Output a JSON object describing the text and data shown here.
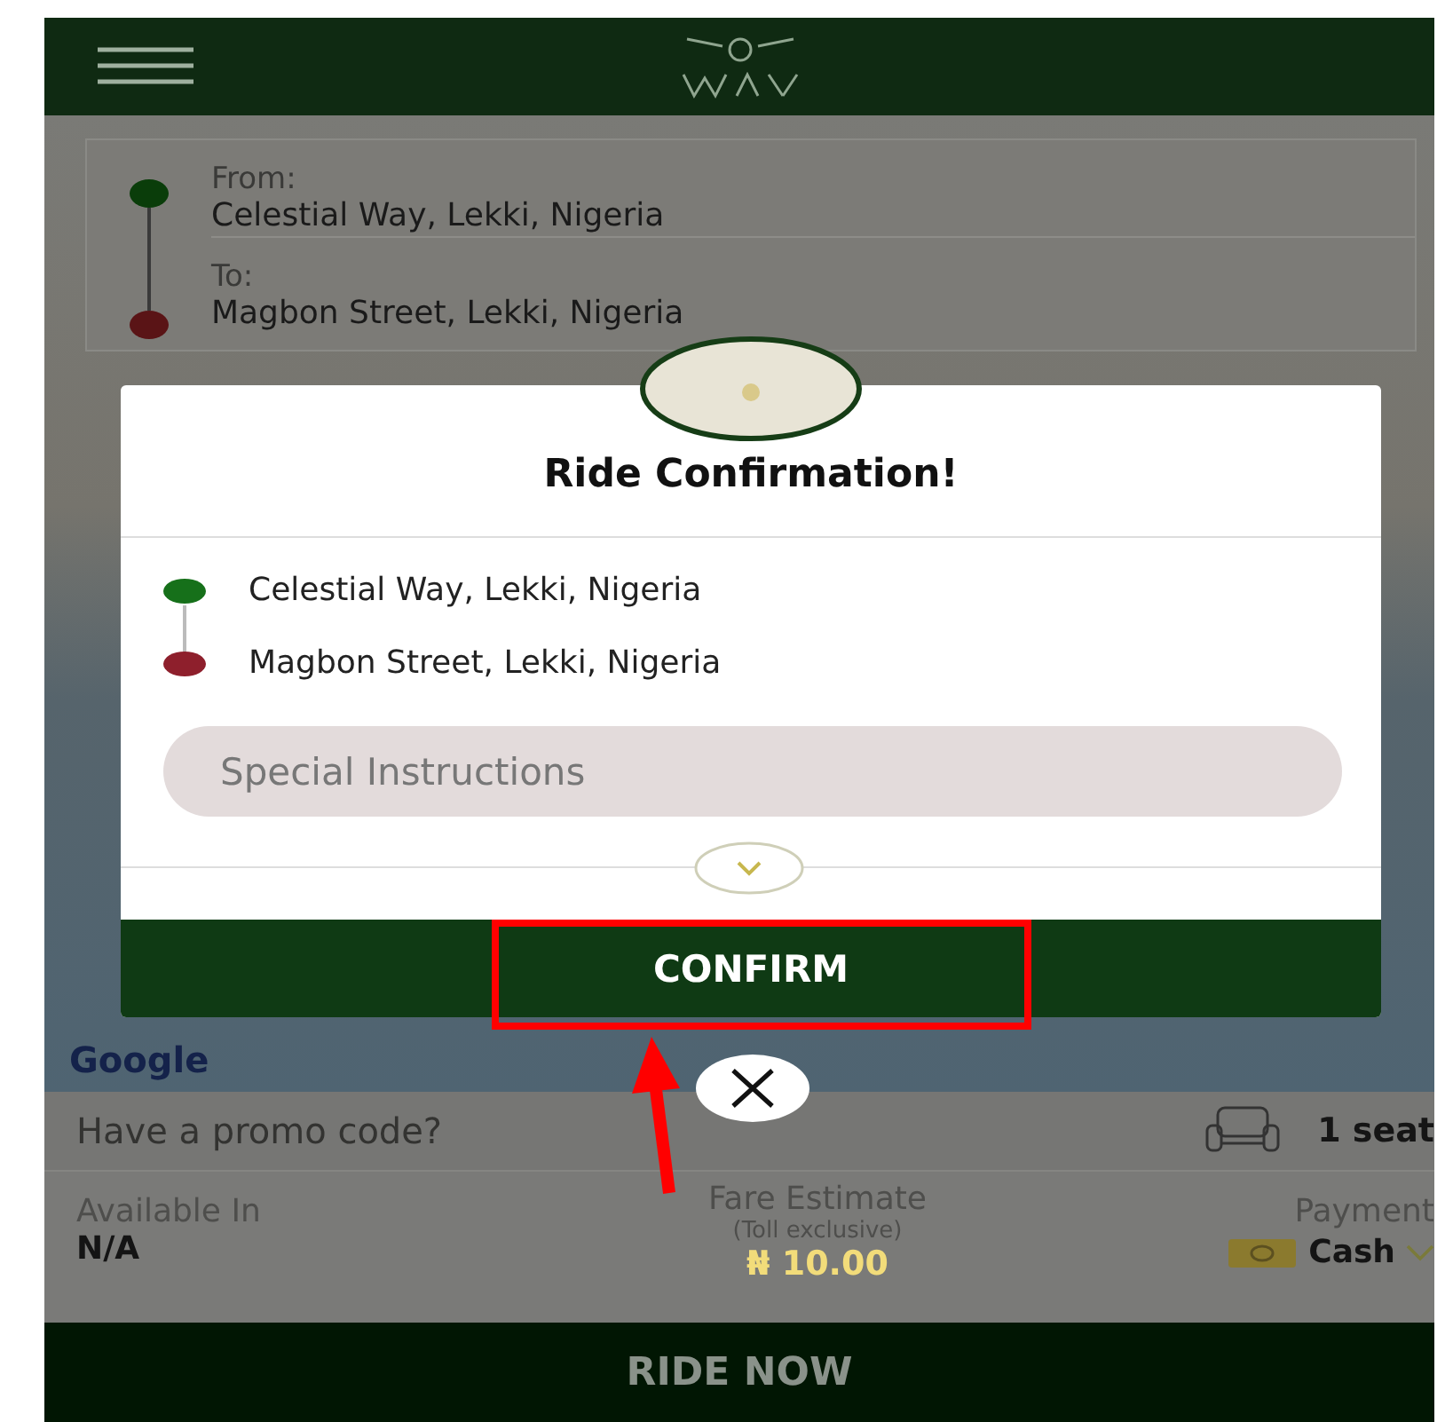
{
  "route_card": {
    "from_label": "From:",
    "from": "Celestial Way, Lekki, Nigeria",
    "to_label": "To:",
    "to": "Magbon Street, Lekki, Nigeria"
  },
  "map": {
    "attribution": "Google"
  },
  "modal": {
    "title": "Ride Confirmation!",
    "stops": [
      {
        "address": "Celestial Way, Lekki, Nigeria",
        "color": "#16701a"
      },
      {
        "address": "Magbon Street, Lekki, Nigeria",
        "color": "#8e1f2c"
      }
    ],
    "special_instructions": {
      "placeholder": "Special Instructions"
    },
    "confirm": "CONFIRM"
  },
  "promo": {
    "placeholder": "Have a promo code?",
    "seats": "1 seat"
  },
  "info": {
    "available_label": "Available In",
    "available_value": "N/A",
    "fare_label": "Fare Estimate",
    "fare_note": "(Toll exclusive)",
    "fare": "₦ 10.00",
    "payment_label": "Payment",
    "payment_value": "Cash"
  },
  "ride_now": "RIDE NOW"
}
